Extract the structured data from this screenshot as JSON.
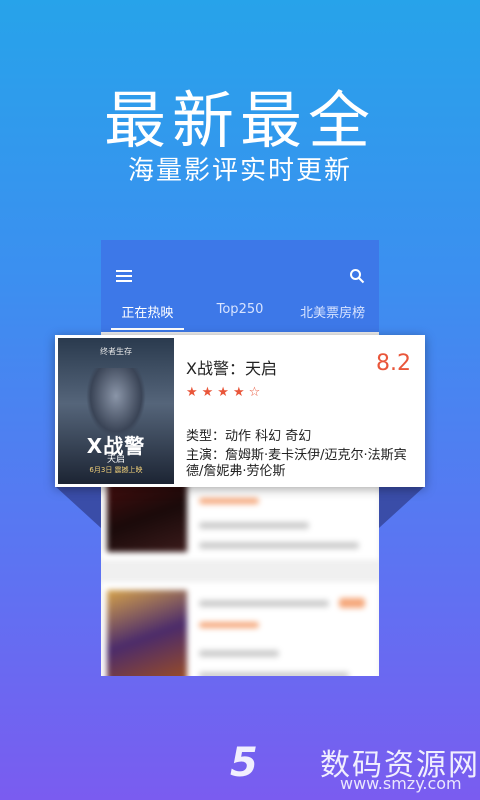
{
  "hero": {
    "headline": "最新最全",
    "subheadline": "海量影评实时更新"
  },
  "app": {
    "menu_icon": "menu-icon",
    "search_icon": "search-icon",
    "tabs": [
      {
        "label": "正在热映",
        "active": true
      },
      {
        "label": "Top250",
        "active": false
      },
      {
        "label": "北美票房榜",
        "active": false
      }
    ],
    "accent_color": "#3d78e8",
    "score_color": "#e9563a"
  },
  "featured_movie": {
    "title": "X战警：天启",
    "score": "8.2",
    "stars": "★★★★☆",
    "genre": "类型：动作 科幻 奇幻",
    "cast": "主演：詹姆斯·麦卡沃伊/迈克尔·法斯宾德/詹妮弗·劳伦斯",
    "poster": {
      "tagline": "终者生存",
      "logo": "X战警",
      "subtitle": "天启",
      "date": "6月3日 震撼上映"
    }
  },
  "watermark": {
    "logo": "5",
    "text": "数码资源网",
    "url": "www.smzy.com"
  }
}
